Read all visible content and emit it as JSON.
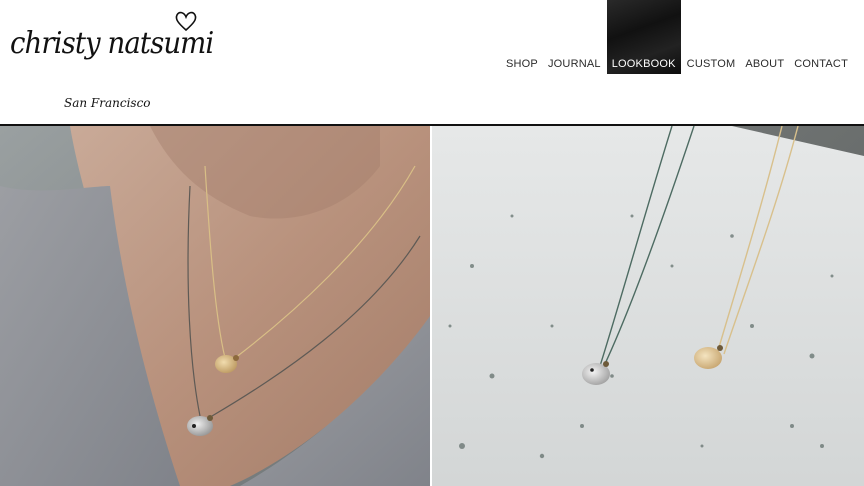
{
  "site": {
    "brand_name": "christy natsumi",
    "brand_location": "San Francisco"
  },
  "nav": {
    "items": [
      {
        "label": "SHOP",
        "active": false
      },
      {
        "label": "JOURNAL",
        "active": false
      },
      {
        "label": "LOOKBOOK",
        "active": true
      },
      {
        "label": "CUSTOM",
        "active": false
      },
      {
        "label": "ABOUT",
        "active": false
      },
      {
        "label": "CONTACT",
        "active": false
      }
    ]
  },
  "colors": {
    "accent_active_bg": "#1a1a1a",
    "nav_text": "#2b2b2b",
    "divider": "#111111"
  },
  "icons": {
    "logo_heart": "heart-icon"
  }
}
